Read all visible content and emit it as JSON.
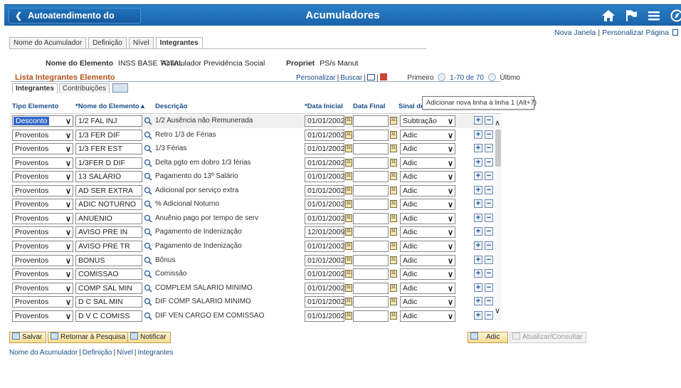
{
  "header": {
    "home_label": "Autoatendimento do Gerente",
    "title": "Acumuladores",
    "icons": [
      "home-icon",
      "flag-icon",
      "menu-icon",
      "navbar-icon"
    ]
  },
  "top_links": {
    "new_window": "Nova Janela",
    "sep": "|",
    "personalize": "Personalizar Página"
  },
  "page_tabs": [
    "Nome do Acumulador",
    "Definição",
    "Nível",
    "Integrantes"
  ],
  "fields": {
    "elem_label": "Nome do Elemento",
    "elem_value": "INSS BASE TOTAL",
    "elem_desc": "Acumulador Previdência Social",
    "owner_label": "Propriet",
    "owner_value": "PS/s Manut"
  },
  "grid": {
    "title": "Lista Integrantes Elemento",
    "personalize": "Personalizar",
    "find": "Buscar",
    "first": "Primeiro",
    "range": "1-70 de 70",
    "last": "Último",
    "tabs": [
      "Integrantes",
      "Contribuições"
    ],
    "columns": {
      "tipo": "Tipo Elemento",
      "nome": "*Nome do Elemento",
      "descricao": "Descrição",
      "data_inicial": "*Data Inicial",
      "data_final": "Data Final",
      "sinal": "Sinal do Acumulador"
    },
    "tooltip": "Adicionar nova linha à linha 1 (Alt+7)",
    "rows": [
      {
        "tipo": "Desconto",
        "nome": "1/2 FAL INJ",
        "desc": "1/2 Ausência não Remunerada",
        "data": "01/01/2002",
        "sinal": "Subtração"
      },
      {
        "tipo": "Proventos",
        "nome": "1/3 FER DIF",
        "desc": "Retro 1/3 de Férias",
        "data": "01/01/2002",
        "sinal": "Adic"
      },
      {
        "tipo": "Proventos",
        "nome": "1/3 FER EST",
        "desc": "1/3 Férias",
        "data": "01/01/2002",
        "sinal": "Adic"
      },
      {
        "tipo": "Proventos",
        "nome": "1/3FER D DIF",
        "desc": "Delta pgto em dobro 1/3 férias",
        "data": "01/01/2002",
        "sinal": "Adic"
      },
      {
        "tipo": "Proventos",
        "nome": "13 SALÁRIO",
        "desc": "Pagamento do 13º Salário",
        "data": "01/01/2002",
        "sinal": "Adic"
      },
      {
        "tipo": "Proventos",
        "nome": "AD SER EXTRA",
        "desc": "Adicional por serviço extra",
        "data": "01/01/2002",
        "sinal": "Adic"
      },
      {
        "tipo": "Proventos",
        "nome": "ADIC NOTURNO",
        "desc": "% Adicional Noturno",
        "data": "01/01/2002",
        "sinal": "Adic"
      },
      {
        "tipo": "Proventos",
        "nome": "ANUENIO",
        "desc": "Anuênio pago por tempo de serv",
        "data": "01/01/2002",
        "sinal": "Adic"
      },
      {
        "tipo": "Proventos",
        "nome": "AVISO PRE IN",
        "desc": "Pagamento de Indenização",
        "data": "12/01/2009",
        "sinal": "Adic"
      },
      {
        "tipo": "Proventos",
        "nome": "AVISO PRE TR",
        "desc": "Pagamento de Indenização",
        "data": "01/01/2002",
        "sinal": "Adic"
      },
      {
        "tipo": "Proventos",
        "nome": "BONUS",
        "desc": "Bônus",
        "data": "01/01/2002",
        "sinal": "Adic"
      },
      {
        "tipo": "Proventos",
        "nome": "COMISSAO",
        "desc": "Comissão",
        "data": "01/01/2002",
        "sinal": "Adic"
      },
      {
        "tipo": "Proventos",
        "nome": "COMP SAL MIN",
        "desc": "COMPLEM SALARIO MINIMO",
        "data": "01/01/2002",
        "sinal": "Adic"
      },
      {
        "tipo": "Proventos",
        "nome": "D C SAL MIN",
        "desc": "DIF COMP SALARIO MINIMO",
        "data": "01/01/2002",
        "sinal": "Adic"
      },
      {
        "tipo": "Proventos",
        "nome": "D V C COMISS",
        "desc": "DIF VEN CARGO EM COMISSAO",
        "data": "01/01/2002",
        "sinal": "Adic"
      }
    ]
  },
  "buttons": {
    "save": "Salvar",
    "return": "Retornar à Pesquisa",
    "notify": "Notificar",
    "add": "Adic",
    "update": "Atualizar/Consultar"
  },
  "bottom_links": [
    "Nome do Acumulador",
    "Definição",
    "Nível",
    "Integrantes"
  ]
}
